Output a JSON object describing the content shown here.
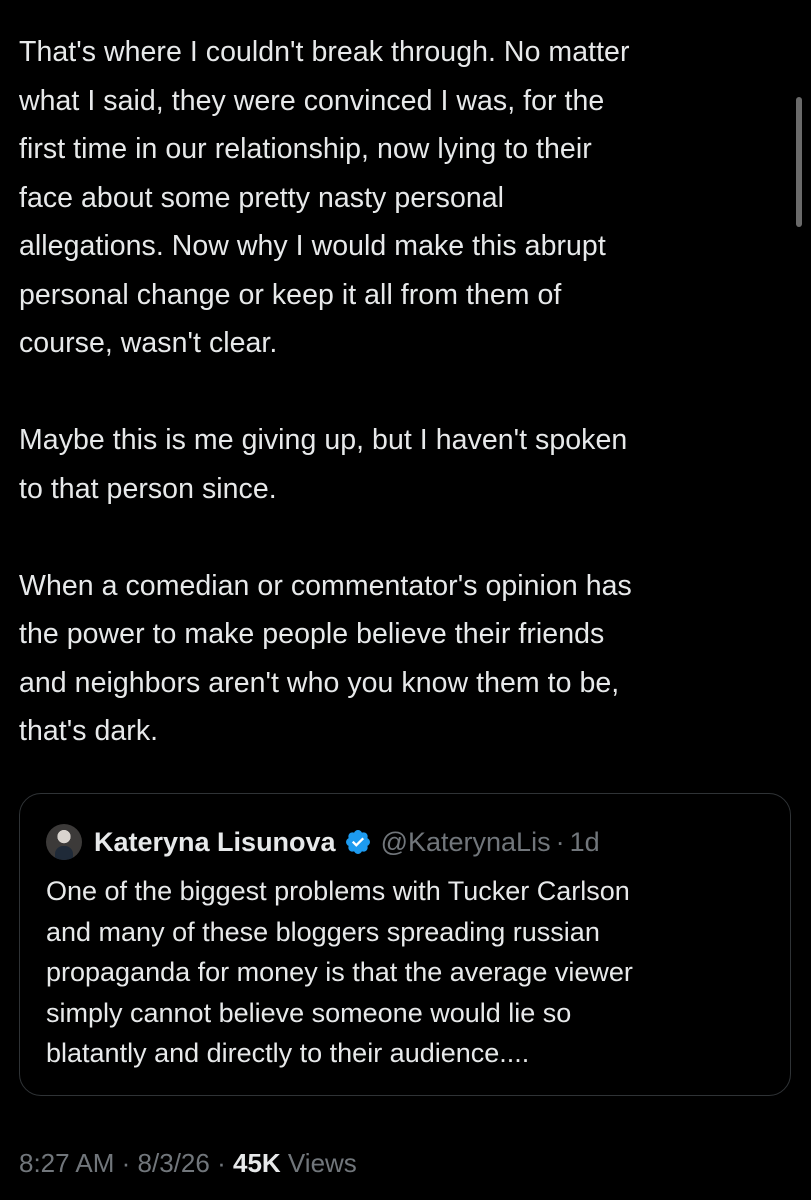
{
  "tweet": {
    "paragraphs": [
      [
        "That's where I couldn't break through.  No matter",
        "what I said, they were convinced I was, for the",
        "first time in our relationship, now lying to their",
        "face about some pretty nasty personal",
        "allegations.  Now why I would make this abrupt",
        "personal change or keep it all from them of",
        "course, wasn't clear."
      ],
      [
        "Maybe this is me giving up, but I haven't spoken",
        "to that person since."
      ],
      [
        "When a comedian or commentator's opinion has",
        "the power to make people believe their friends",
        "and neighbors aren't who you know them to be,",
        "that's dark."
      ]
    ]
  },
  "quoted_tweet": {
    "author_name": "Kateryna Lisunova",
    "handle": "@KaterynaLis",
    "separator": "·",
    "age": "1d",
    "verified_icon": "verified-badge-icon",
    "lines": [
      "One of the biggest problems with Tucker Carlson",
      "and many of these bloggers spreading russian",
      "propaganda for money is that the average viewer",
      "simply cannot believe someone would lie so",
      "blatantly and directly to their audience...."
    ]
  },
  "meta": {
    "time": "8:27 AM",
    "separator": "·",
    "date": "8/3/26",
    "views_count": "45K",
    "views_label": "Views"
  },
  "colors": {
    "background": "#000000",
    "text": "#e7e9ea",
    "secondary_text": "#71767b",
    "border": "#2f3336",
    "verified_blue": "#1d9bf0"
  }
}
